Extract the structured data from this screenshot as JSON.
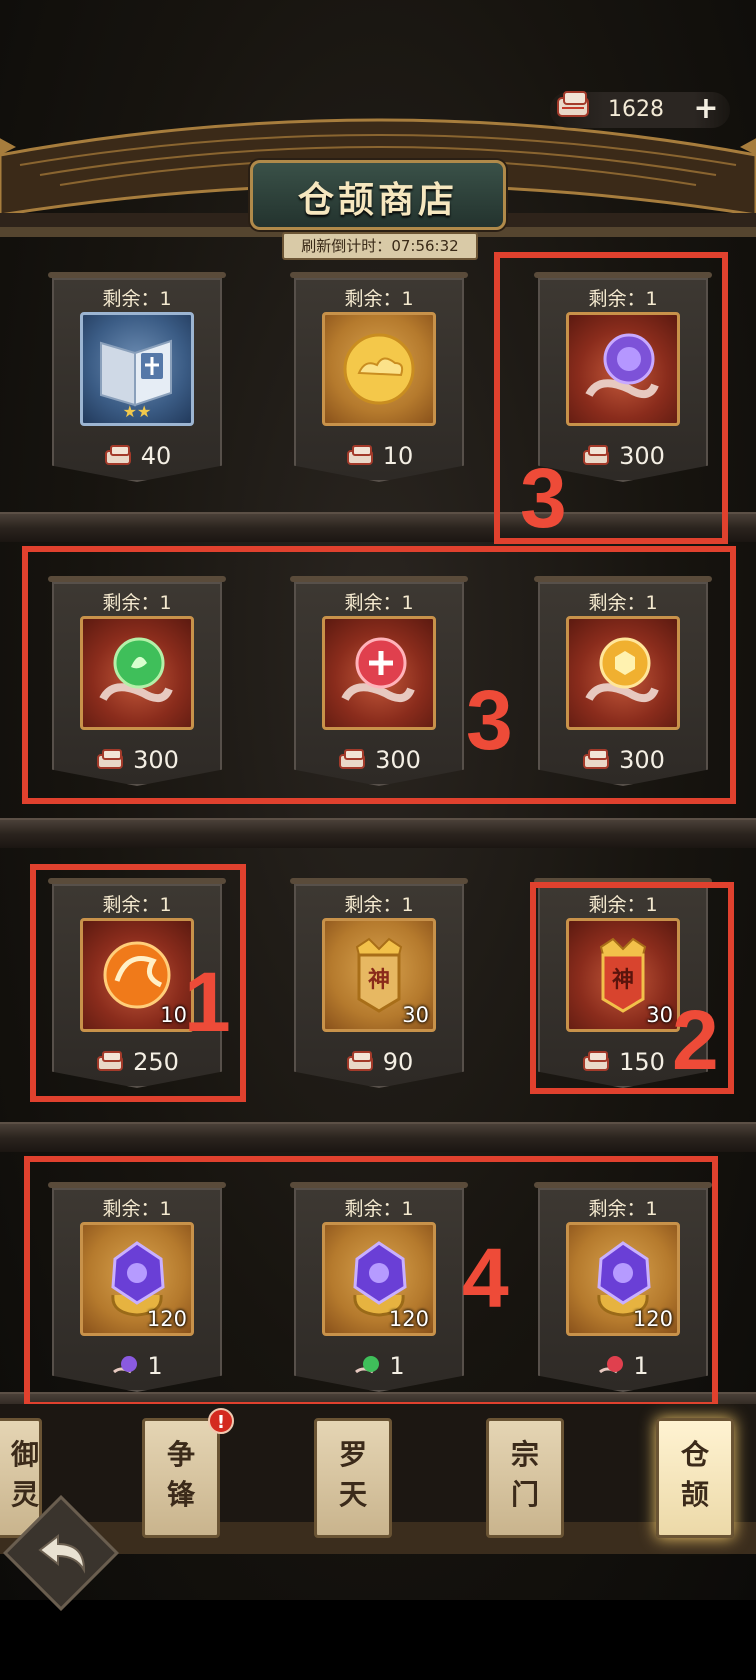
{
  "currency": {
    "icon": "scroll-coupon-icon",
    "amount": "1628",
    "add_label": "+"
  },
  "header": {
    "title": "仓颉商店",
    "timer_label": "刷新倒计时：",
    "timer_value": "07:56:32"
  },
  "rows": [
    {
      "items": [
        {
          "remain": "剩余：1",
          "icon": "book-star-icon",
          "stars": "★★",
          "qty": "",
          "price": "40",
          "price_icon": "scroll-coupon-icon"
        },
        {
          "remain": "剩余：1",
          "icon": "gold-cloud-coin-icon",
          "qty": "",
          "price": "10",
          "price_icon": "scroll-coupon-icon"
        },
        {
          "remain": "剩余：1",
          "icon": "purple-soul-orb-icon",
          "qty": "",
          "price": "300",
          "price_icon": "scroll-coupon-icon"
        }
      ]
    },
    {
      "items": [
        {
          "remain": "剩余：1",
          "icon": "green-leaf-orb-icon",
          "qty": "",
          "price": "300",
          "price_icon": "scroll-coupon-icon"
        },
        {
          "remain": "剩余：1",
          "icon": "red-cross-orb-icon",
          "qty": "",
          "price": "300",
          "price_icon": "scroll-coupon-icon"
        },
        {
          "remain": "剩余：1",
          "icon": "yellow-hex-orb-icon",
          "qty": "",
          "price": "300",
          "price_icon": "scroll-coupon-icon"
        }
      ]
    },
    {
      "items": [
        {
          "remain": "剩余：1",
          "icon": "fire-orb-icon",
          "qty": "10",
          "price": "250",
          "price_icon": "scroll-coupon-icon"
        },
        {
          "remain": "剩余：1",
          "icon": "gold-shen-plaque-icon",
          "plaque_text": "神",
          "qty": "30",
          "price": "90",
          "price_icon": "scroll-coupon-icon"
        },
        {
          "remain": "剩余：1",
          "icon": "red-shen-plaque-icon",
          "plaque_text": "神",
          "qty": "30",
          "price": "150",
          "price_icon": "scroll-coupon-icon"
        }
      ]
    },
    {
      "items": [
        {
          "remain": "剩余：1",
          "icon": "purple-crystal-icon",
          "qty": "120",
          "price": "1",
          "price_icon": "purple-orb-small-icon"
        },
        {
          "remain": "剩余：1",
          "icon": "purple-crystal-icon",
          "qty": "120",
          "price": "1",
          "price_icon": "green-orb-small-icon"
        },
        {
          "remain": "剩余：1",
          "icon": "purple-crystal-icon",
          "qty": "120",
          "price": "1",
          "price_icon": "red-orb-small-icon"
        }
      ]
    }
  ],
  "annotations": [
    "3",
    "3",
    "1",
    "2",
    "4"
  ],
  "tabs": [
    {
      "label": "御灵",
      "active": false
    },
    {
      "label": "争锋",
      "active": false,
      "badge": "!"
    },
    {
      "label": "罗天",
      "active": false
    },
    {
      "label": "宗门",
      "active": false
    },
    {
      "label": "仓颉",
      "active": true
    }
  ],
  "colors": {
    "annotation_red": "#e0412e",
    "gold_frame": "#c8924a",
    "accent_red": "#d42a1f"
  }
}
